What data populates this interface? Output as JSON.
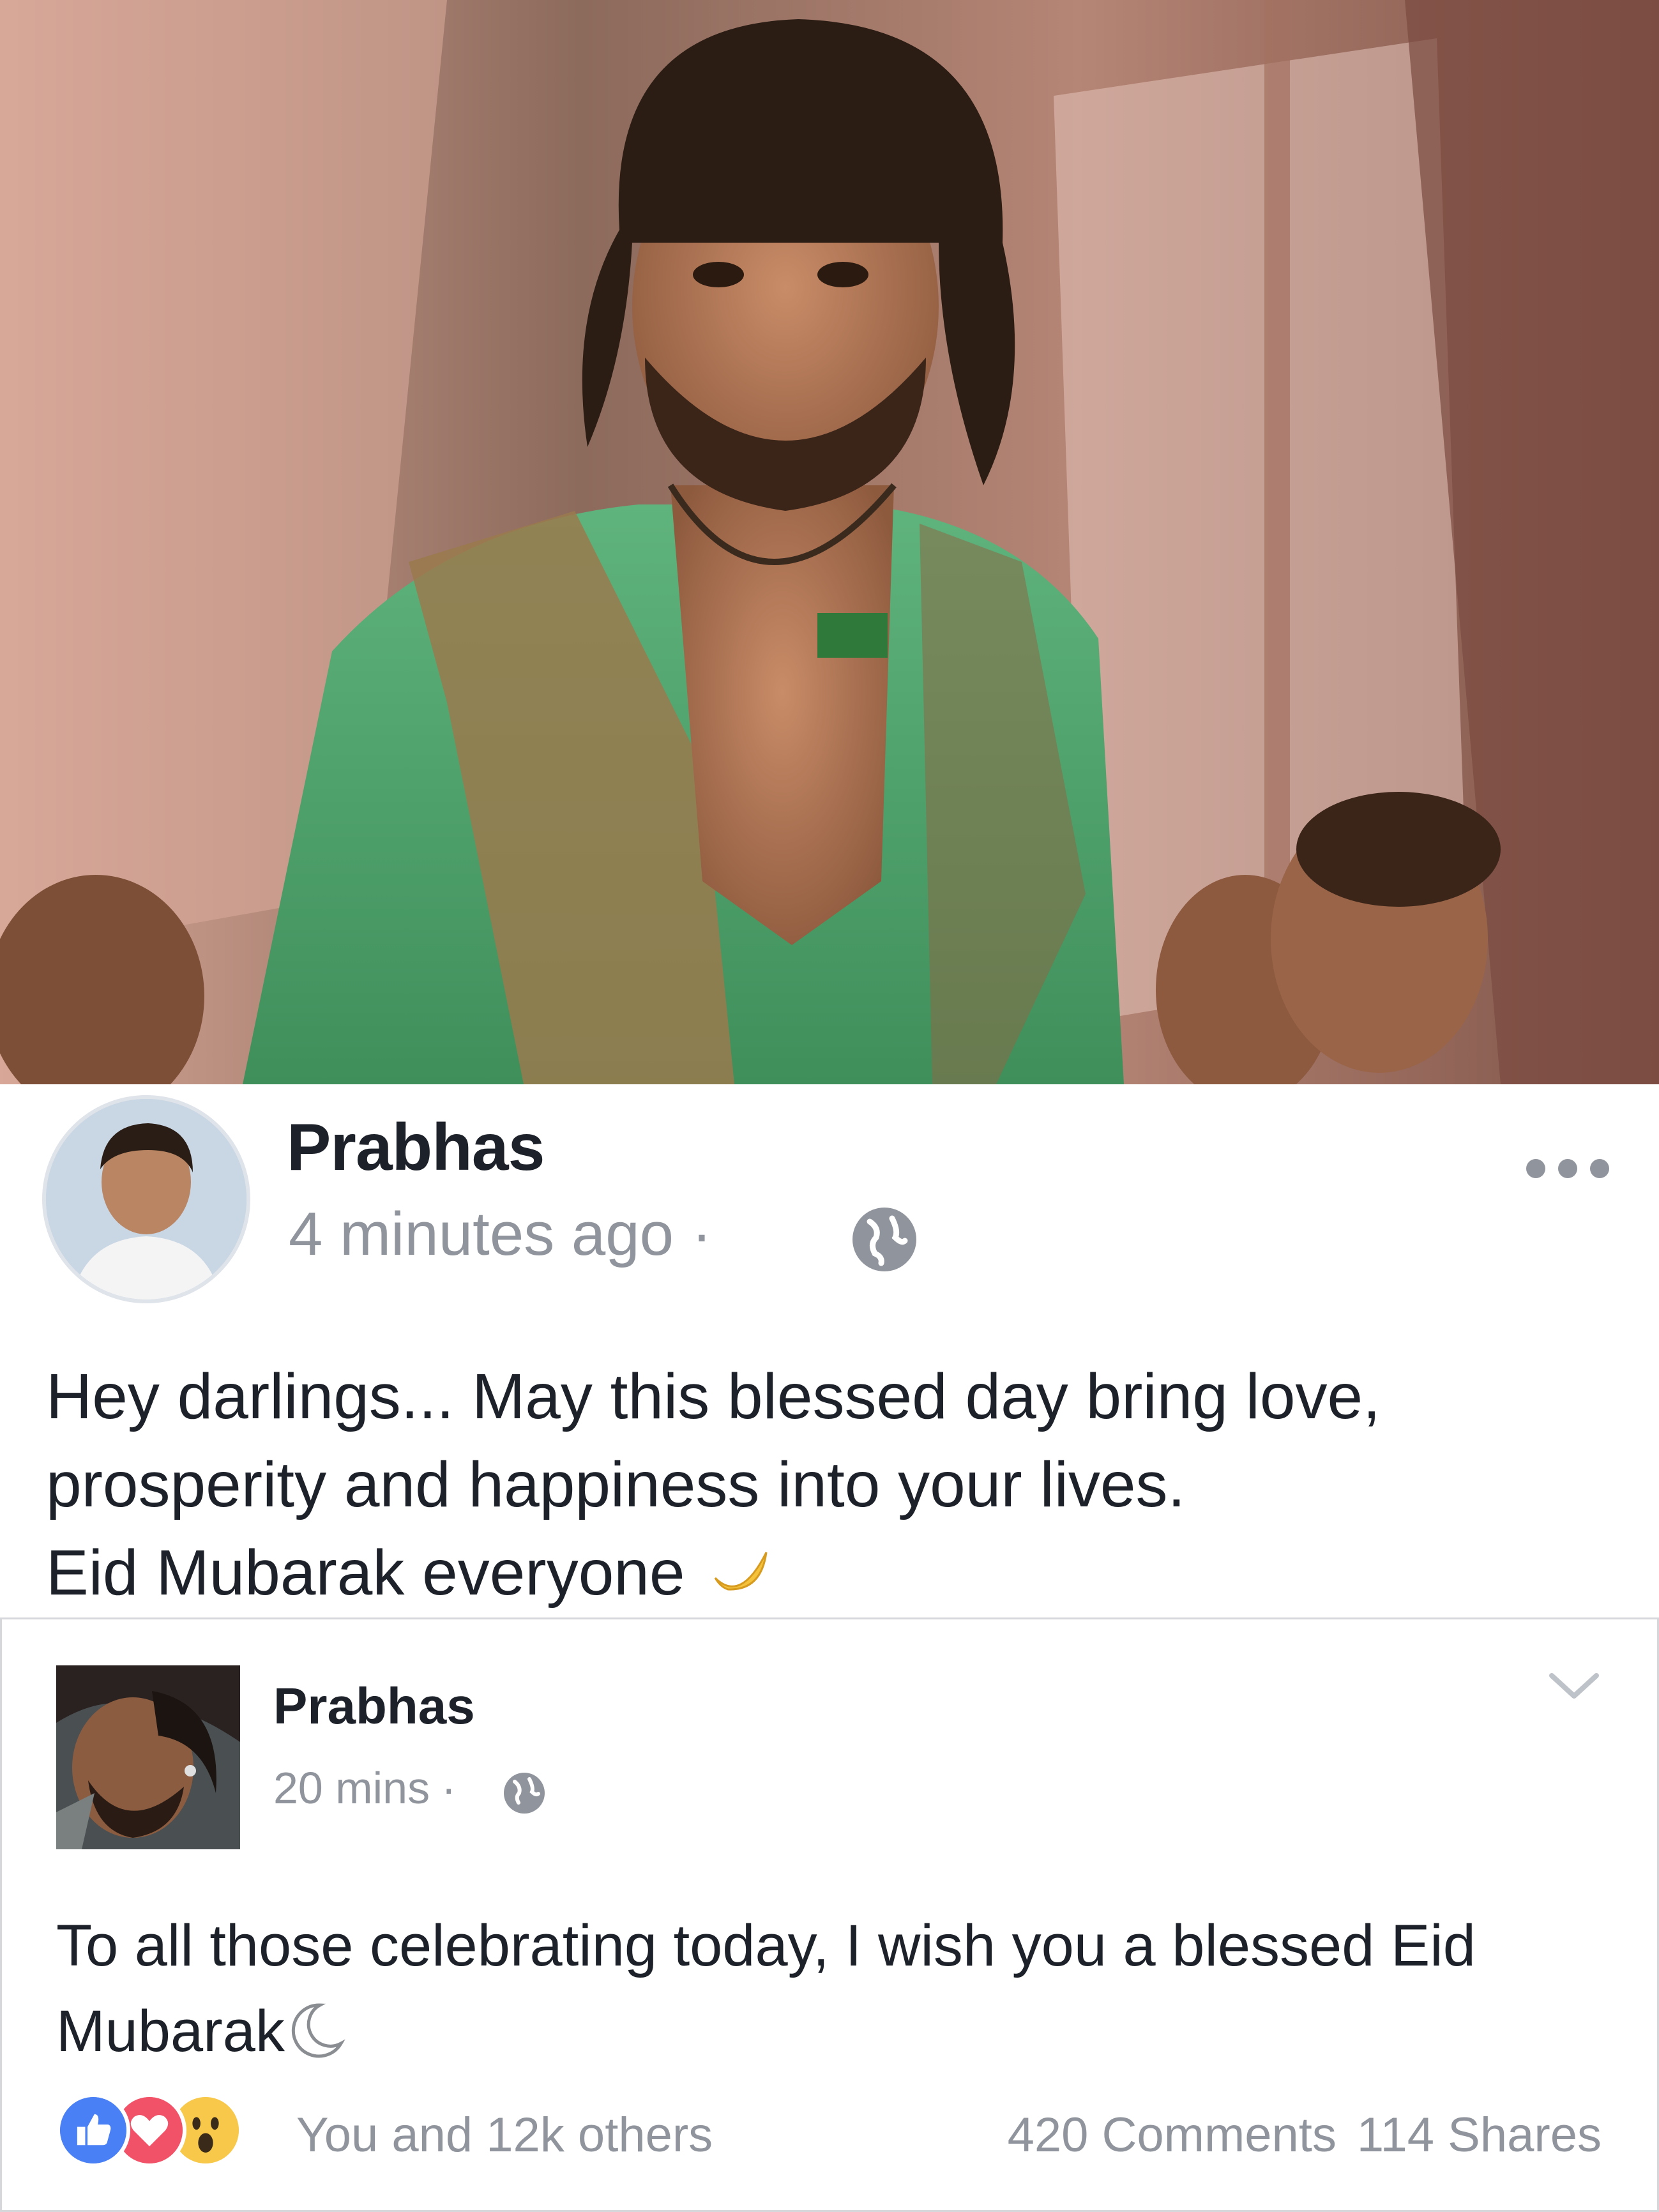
{
  "post": {
    "author": "Prabhas",
    "time": "4 minutes ago",
    "separator": "·",
    "audience_icon": "globe-icon",
    "more_icon": "more-options-icon",
    "text_line1": "Hey darlings... May this blessed day bring love,",
    "text_line2": "prosperity and happiness into your lives.",
    "text_line3": "Eid Mubarak everyone",
    "emoji": "crescent-moon-icon"
  },
  "shared_post": {
    "author": "Prabhas",
    "time": "20 mins",
    "separator": "·",
    "audience_icon": "globe-icon",
    "menu_icon": "chevron-down-icon",
    "text_line1": "To all those celebrating today, I wish you a blessed Eid",
    "text_line2": "Mubarak",
    "emoji": "crescent-moon-icon",
    "reactions": [
      "like-icon",
      "love-icon",
      "wow-icon"
    ],
    "reaction_summary": "You and 12k others",
    "comments": "420 Comments",
    "shares": "114 Shares"
  },
  "colors": {
    "text": "#1d2129",
    "meta": "#90949c",
    "like": "#4a80f5",
    "love": "#f25268",
    "wow": "#f7c84a"
  }
}
